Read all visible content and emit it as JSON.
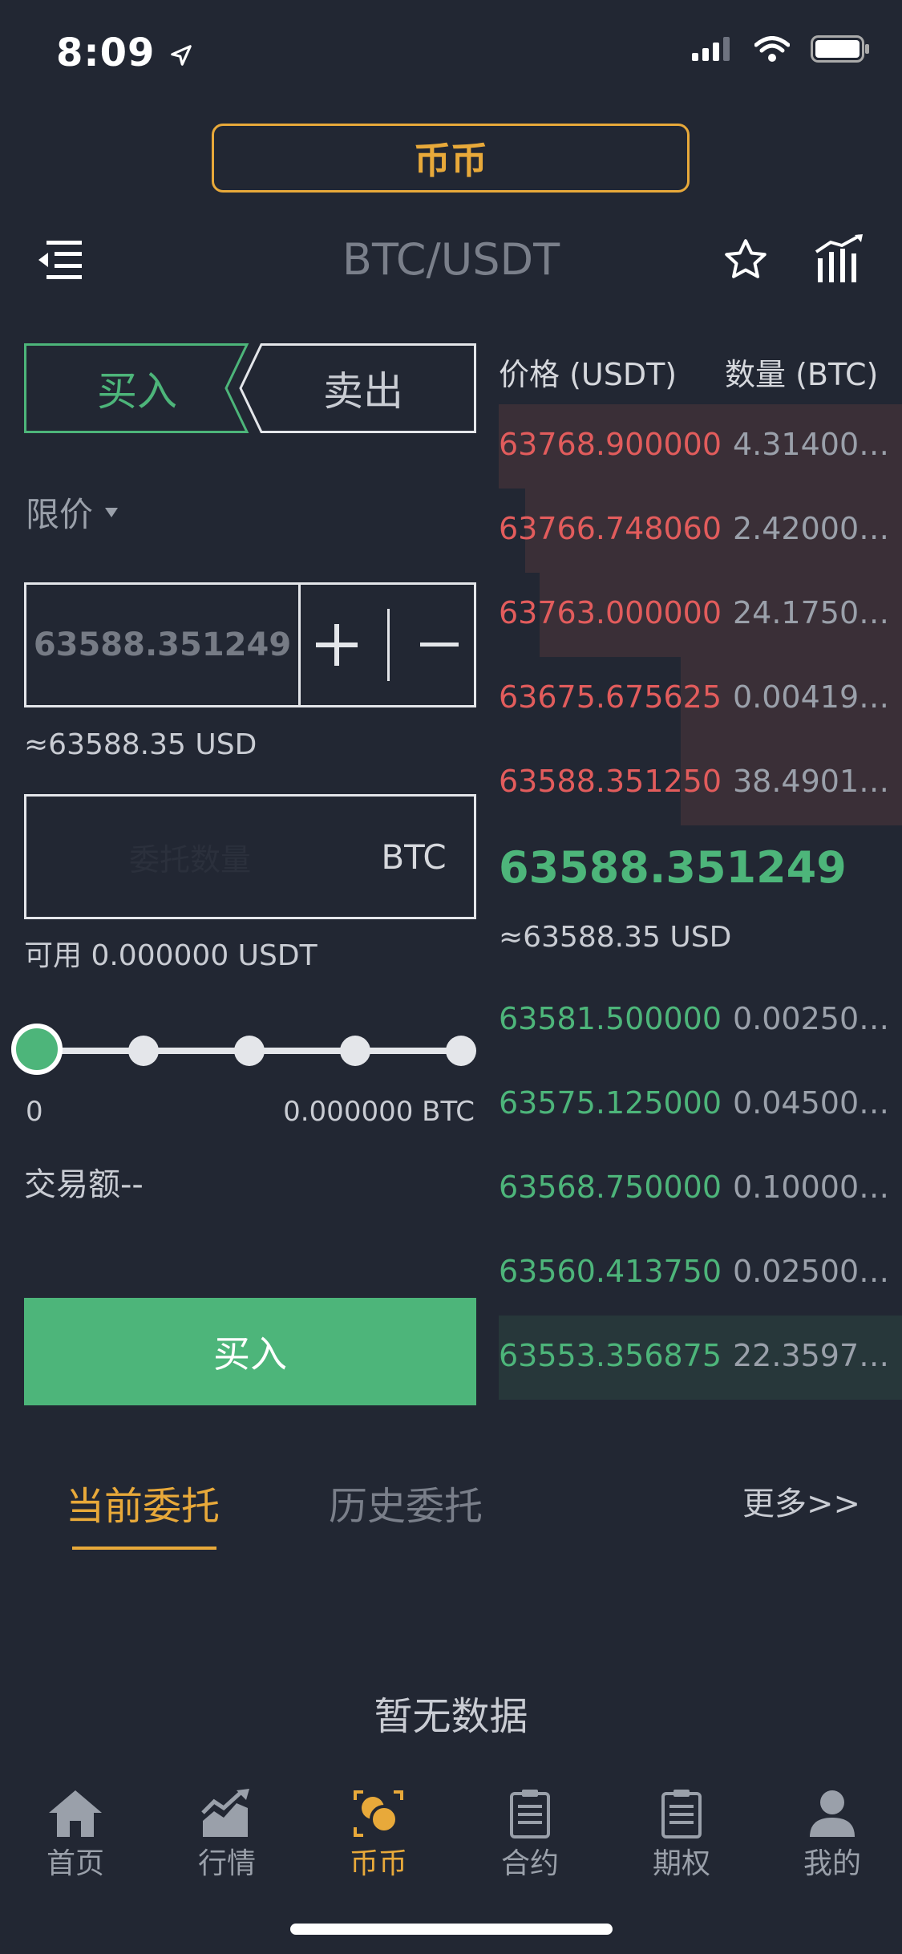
{
  "status_bar": {
    "time": "8:09"
  },
  "header": {
    "mode_tab": "币币",
    "pair": "BTC/USDT"
  },
  "trade_form": {
    "buy_tab": "买入",
    "sell_tab": "卖出",
    "order_type": "限价",
    "price_value": "63588.351249",
    "price_approx": "≈63588.35 USD",
    "quantity_placeholder": "委托数量",
    "quantity_unit": "BTC",
    "available": "可用 0.000000 USDT",
    "slider_min": "0",
    "slider_max": "0.000000 BTC",
    "trade_amount": "交易额--",
    "submit_label": "买入"
  },
  "order_book": {
    "price_header": "价格 (USDT)",
    "qty_header": "数量 (BTC)",
    "asks": [
      {
        "price": "63768.900000",
        "qty": "4.31400…"
      },
      {
        "price": "63766.748060",
        "qty": "2.42000…"
      },
      {
        "price": "63763.000000",
        "qty": "24.1750…"
      },
      {
        "price": "63675.675625",
        "qty": "0.00419…"
      },
      {
        "price": "63588.351250",
        "qty": "38.4901…"
      }
    ],
    "last_price": "63588.351249",
    "last_price_usd": "≈63588.35 USD",
    "bids": [
      {
        "price": "63581.500000",
        "qty": "0.00250…"
      },
      {
        "price": "63575.125000",
        "qty": "0.04500…"
      },
      {
        "price": "63568.750000",
        "qty": "0.10000…"
      },
      {
        "price": "63560.413750",
        "qty": "0.02500…"
      },
      {
        "price": "63553.356875",
        "qty": "22.3597…"
      }
    ]
  },
  "orders": {
    "tab_current": "当前委托",
    "tab_history": "历史委托",
    "more": "更多>>",
    "empty": "暂无数据"
  },
  "bottom_nav": {
    "items": [
      {
        "label": "首页",
        "icon": "home-icon"
      },
      {
        "label": "行情",
        "icon": "market-chart-icon"
      },
      {
        "label": "币币",
        "icon": "coin-trade-icon"
      },
      {
        "label": "合约",
        "icon": "contract-icon"
      },
      {
        "label": "期权",
        "icon": "options-icon"
      },
      {
        "label": "我的",
        "icon": "profile-icon"
      }
    ]
  },
  "colors": {
    "background": "#222733",
    "buy_green": "#4db57a",
    "sell_red": "#e25c5c",
    "accent_gold": "#e8a93a"
  }
}
